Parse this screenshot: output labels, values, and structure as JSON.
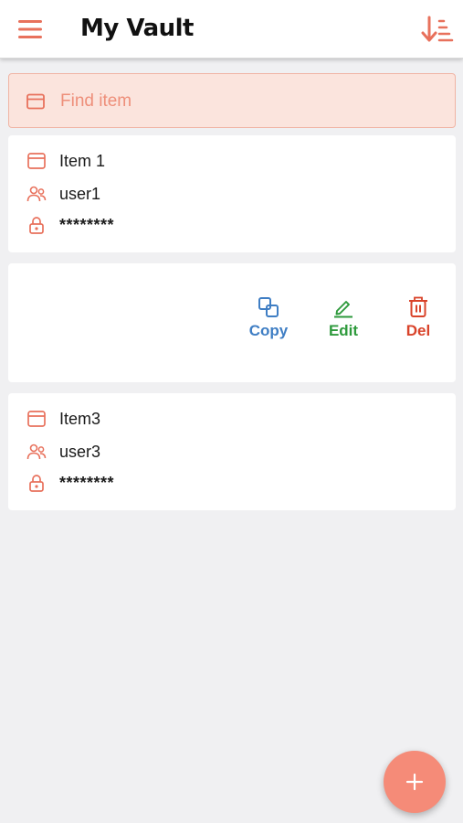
{
  "colors": {
    "accent": "#e8715c",
    "copy": "#3f7ec4",
    "edit": "#2e9a3c",
    "delete": "#d9432a",
    "fab": "#f58b78",
    "search_bg": "#fbe4dd"
  },
  "header": {
    "title": "My Vault",
    "menu_icon": "hamburger-menu-icon",
    "sort_icon": "sort-descending-icon"
  },
  "search": {
    "placeholder": "Find item",
    "value": "",
    "icon": "window-icon"
  },
  "items": [
    {
      "name": "Item 1",
      "username": "user1",
      "password": "********"
    },
    {
      "name": "Item3",
      "username": "user3",
      "password": "********"
    }
  ],
  "actions": {
    "copy_label": "Copy",
    "edit_label": "Edit",
    "delete_label": "Del"
  },
  "fab": {
    "icon": "plus-icon",
    "label": "+"
  }
}
